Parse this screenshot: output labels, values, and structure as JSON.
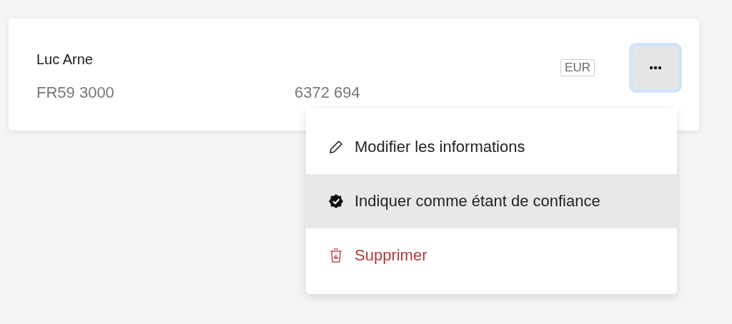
{
  "account": {
    "name": "Luc Arne",
    "iban_parts": [
      "FR59 3000",
      "6372 694"
    ],
    "currency": "EUR"
  },
  "menu_button": {
    "focused": true
  },
  "menu": {
    "items": [
      {
        "kind": "edit",
        "label": "Modifier les informations",
        "selected": false
      },
      {
        "kind": "trust",
        "label": "Indiquer comme étant de confiance",
        "selected": true
      },
      {
        "kind": "delete",
        "label": "Supprimer",
        "selected": false
      }
    ]
  }
}
